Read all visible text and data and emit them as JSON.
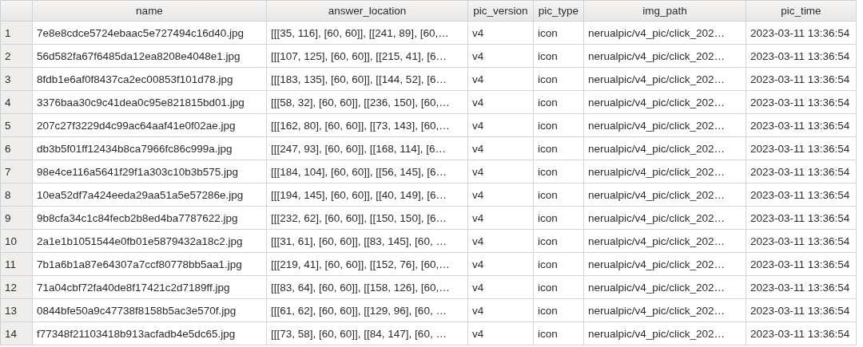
{
  "table": {
    "columns": [
      "name",
      "answer_location",
      "pic_version",
      "pic_type",
      "img_path",
      "pic_time"
    ],
    "rows": [
      {
        "number": "1",
        "cells": [
          "7e8e8cdce5724ebaac5e727494c16d40.jpg",
          "[[[35, 116], [60, 60]], [[241, 89], [60,…",
          "v4",
          "icon",
          "nerualpic/v4_pic/click_202…",
          "2023-03-11 13:36:54"
        ]
      },
      {
        "number": "2",
        "cells": [
          "56d582fa67f6485da12ea8208e4048e1.jpg",
          "[[[107, 125], [60, 60]], [[215, 41], [6…",
          "v4",
          "icon",
          "nerualpic/v4_pic/click_202…",
          "2023-03-11 13:36:54"
        ]
      },
      {
        "number": "3",
        "cells": [
          "8fdb1e6af0f8437ca2ec00853f101d78.jpg",
          "[[[183, 135], [60, 60]], [[144, 52], [6…",
          "v4",
          "icon",
          "nerualpic/v4_pic/click_202…",
          "2023-03-11 13:36:54"
        ]
      },
      {
        "number": "4",
        "cells": [
          "3376baa30c9c41dea0c95e821815bd01.jpg",
          "[[[58, 32], [60, 60]], [[236, 150], [60,…",
          "v4",
          "icon",
          "nerualpic/v4_pic/click_202…",
          "2023-03-11 13:36:54"
        ]
      },
      {
        "number": "5",
        "cells": [
          "207c27f3229d4c99ac64aaf41e0f02ae.jpg",
          "[[[162, 80], [60, 60]], [[73, 143], [60,…",
          "v4",
          "icon",
          "nerualpic/v4_pic/click_202…",
          "2023-03-11 13:36:54"
        ]
      },
      {
        "number": "6",
        "cells": [
          "db3b5f01ff12434b8ca7966fc86c999a.jpg",
          "[[[247, 93], [60, 60]], [[168, 114], [6…",
          "v4",
          "icon",
          "nerualpic/v4_pic/click_202…",
          "2023-03-11 13:36:54"
        ]
      },
      {
        "number": "7",
        "cells": [
          "98e4ce116a5641f29f1a303c10b3b575.jpg",
          "[[[184, 104], [60, 60]], [[56, 145], [6…",
          "v4",
          "icon",
          "nerualpic/v4_pic/click_202…",
          "2023-03-11 13:36:54"
        ]
      },
      {
        "number": "8",
        "cells": [
          "10ea52df7a424eeda29aa51a5e57286e.jpg",
          "[[[194, 145], [60, 60]], [[40, 149], [6…",
          "v4",
          "icon",
          "nerualpic/v4_pic/click_202…",
          "2023-03-11 13:36:54"
        ]
      },
      {
        "number": "9",
        "cells": [
          "9b8cfa34c1c84fecb2b8ed4ba7787622.jpg",
          "[[[232, 62], [60, 60]], [[150, 150], [6…",
          "v4",
          "icon",
          "nerualpic/v4_pic/click_202…",
          "2023-03-11 13:36:54"
        ]
      },
      {
        "number": "10",
        "cells": [
          "2a1e1b1051544e0fb01e5879432a18c2.jpg",
          "[[[31, 61], [60, 60]], [[83, 145], [60, …",
          "v4",
          "icon",
          "nerualpic/v4_pic/click_202…",
          "2023-03-11 13:36:54"
        ]
      },
      {
        "number": "11",
        "cells": [
          "7b1a6b1a87e64307a7ccf80778bb5aa1.jpg",
          "[[[219, 41], [60, 60]], [[152, 76], [60,…",
          "v4",
          "icon",
          "nerualpic/v4_pic/click_202…",
          "2023-03-11 13:36:54"
        ]
      },
      {
        "number": "12",
        "cells": [
          "71a04cbf72fa40de8f17421c2d7189ff.jpg",
          "[[[83, 64], [60, 60]], [[158, 126], [60,…",
          "v4",
          "icon",
          "nerualpic/v4_pic/click_202…",
          "2023-03-11 13:36:54"
        ]
      },
      {
        "number": "13",
        "cells": [
          "0844bfe50a9c47738f8158b5ac3e570f.jpg",
          "[[[61, 62], [60, 60]], [[129, 96], [60, …",
          "v4",
          "icon",
          "nerualpic/v4_pic/click_202…",
          "2023-03-11 13:36:54"
        ]
      },
      {
        "number": "14",
        "cells": [
          "f77348f21103418b913acfadb4e5dc65.jpg",
          "[[[73, 58], [60, 60]], [[84, 147], [60, …",
          "v4",
          "icon",
          "nerualpic/v4_pic/click_202…",
          "2023-03-11 13:36:54"
        ]
      }
    ]
  }
}
